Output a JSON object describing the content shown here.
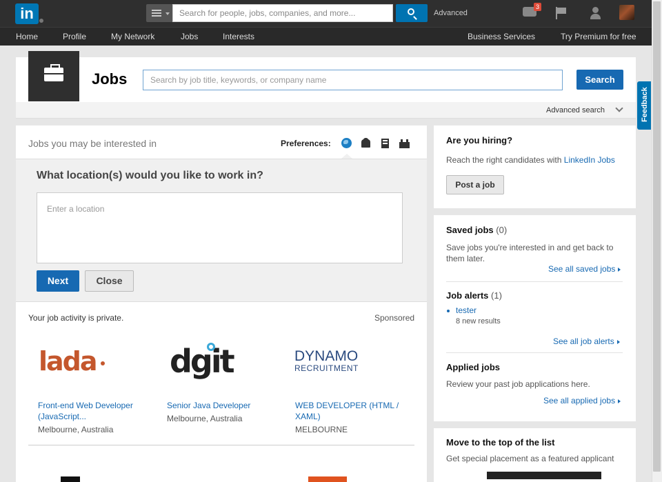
{
  "topbar": {
    "logo_text": "in",
    "search_placeholder": "Search for people, jobs, companies, and more...",
    "advanced_label": "Advanced",
    "messages_badge": "3",
    "icons": [
      "search-icon",
      "messages-icon",
      "flag-icon",
      "add-connection-icon",
      "avatar"
    ]
  },
  "nav": {
    "items": [
      "Home",
      "Profile",
      "My Network",
      "Jobs",
      "Interests"
    ],
    "business_services": "Business Services",
    "premium": "Try Premium for free"
  },
  "feedback": "Feedback",
  "jobs_header": {
    "title": "Jobs",
    "search_placeholder": "Search by job title, keywords, or company name",
    "search_button": "Search",
    "advanced_search": "Advanced search"
  },
  "main": {
    "interest_title": "Jobs you may be interested in",
    "preferences_label": "Preferences:",
    "location_question": "What location(s) would you like to work in?",
    "location_placeholder": "Enter a location",
    "next_button": "Next",
    "close_button": "Close",
    "activity_private": "Your job activity is private.",
    "sponsored": "Sponsored",
    "jobs": [
      {
        "company": "lada",
        "title_line1": "Front-end Web Developer",
        "title_line2": "(JavaScript...",
        "location": "Melbourne, Australia"
      },
      {
        "company": "dgit",
        "title_line1": "Senior Java Developer",
        "title_line2": "",
        "location": "Melbourne, Australia"
      },
      {
        "company_line1": "DYNAMO",
        "company_line2": "RECRUITMENT",
        "title_line1": "WEB DEVELOPER (HTML /",
        "title_line2": "XAML)",
        "location": "MELBOURNE"
      }
    ]
  },
  "sidebar": {
    "hiring": {
      "heading": "Are you hiring?",
      "text": "Reach the right candidates with",
      "link": "LinkedIn Jobs",
      "button": "Post a job"
    },
    "saved_jobs": {
      "heading": "Saved jobs",
      "count": "(0)",
      "text_line1": "Save jobs you're interested in and get back to",
      "text_line2": "them later.",
      "link": "See all saved jobs"
    },
    "job_alerts": {
      "heading": "Job alerts",
      "count": "(1)",
      "alert_name": "tester",
      "alert_results": "8 new results",
      "link": "See all job alerts"
    },
    "applied_jobs": {
      "heading": "Applied jobs",
      "text": "Review your past job applications here.",
      "link": "See all applied jobs"
    },
    "move_top": {
      "heading": "Move to the top of the list",
      "text": "Get special placement as a featured applicant"
    }
  }
}
